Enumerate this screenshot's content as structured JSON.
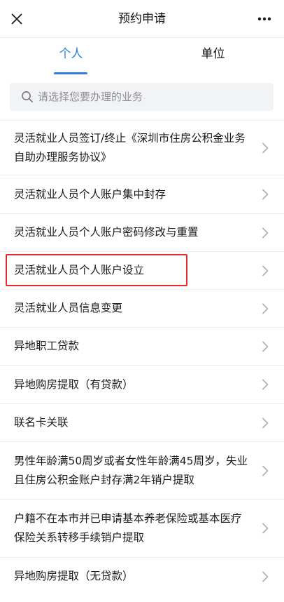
{
  "header": {
    "title": "预约申请",
    "close_icon": "close-icon",
    "more_icon": "more-icon"
  },
  "tabs": [
    {
      "label": "个人",
      "active": true
    },
    {
      "label": "单位",
      "active": false
    }
  ],
  "search": {
    "placeholder": "请选择您要办理的业务",
    "value": "",
    "icon": "search-icon"
  },
  "items": [
    {
      "label": "灵活就业人员签订/终止《深圳市住房公积金业务自助办理服务协议》"
    },
    {
      "label": "灵活就业人员个人账户集中封存"
    },
    {
      "label": "灵活就业人员个人账户密码修改与重置"
    },
    {
      "label": "灵活就业人员个人账户设立",
      "highlighted": true
    },
    {
      "label": "灵活就业人员信息变更"
    },
    {
      "label": "异地职工贷款"
    },
    {
      "label": "异地购房提取（有贷款）"
    },
    {
      "label": "联名卡关联"
    },
    {
      "label": "男性年龄满50周岁或者女性年龄满45周岁，失业且住房公积金账户封存满2年销户提取"
    },
    {
      "label": "户籍不在本市并已申请基本养老保险或基本医疗保险关系转移手续销户提取"
    },
    {
      "label": "异地购房提取（无贷款）"
    }
  ],
  "colors": {
    "accent": "#2d7fe0",
    "highlight_border": "#e02b2b",
    "chevron": "#b2b2b2",
    "search_bg": "#f2f3f5"
  }
}
